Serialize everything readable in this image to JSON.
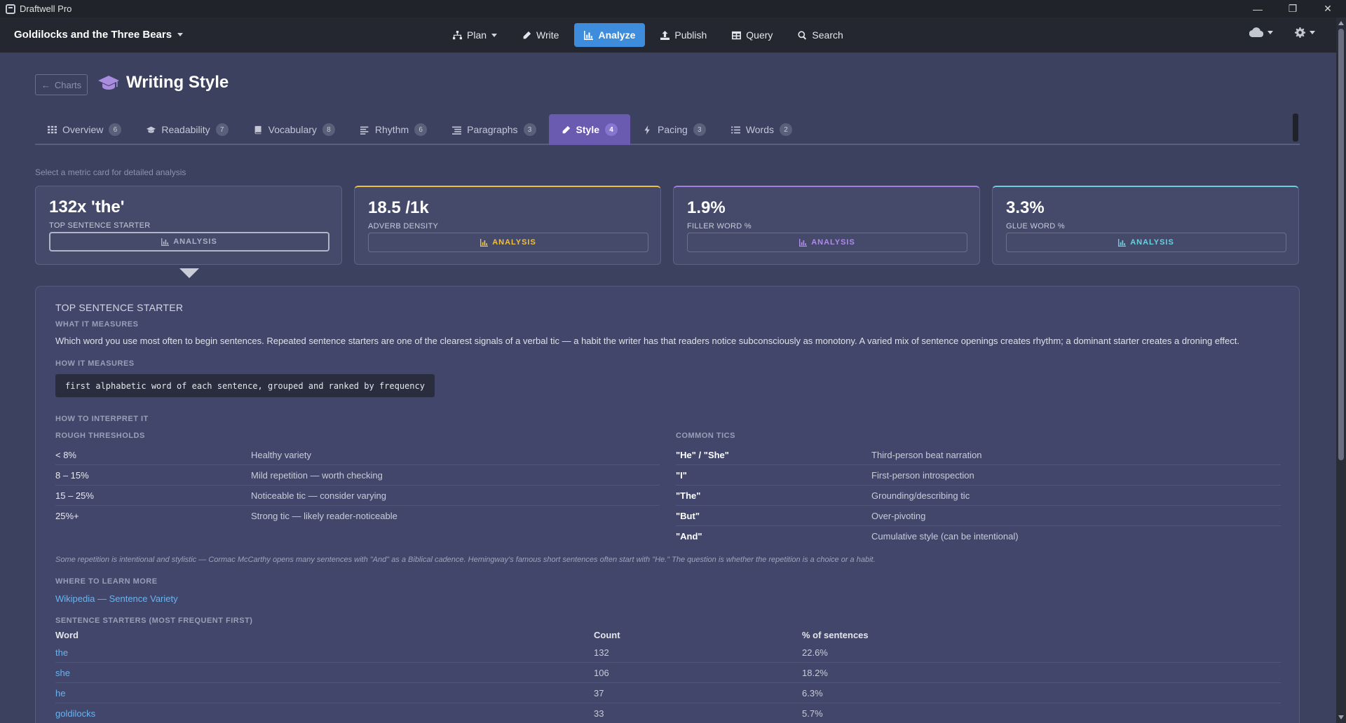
{
  "window": {
    "app_title": "Draftwell Pro"
  },
  "topnav": {
    "doc_title": "Goldilocks and the Three Bears",
    "buttons": [
      {
        "label": "Plan",
        "icon": "sitemap-icon"
      },
      {
        "label": "Write",
        "icon": "pencil-icon"
      },
      {
        "label": "Analyze",
        "icon": "bar-chart-icon",
        "active": true
      },
      {
        "label": "Publish",
        "icon": "upload-icon"
      },
      {
        "label": "Query",
        "icon": "table-icon"
      },
      {
        "label": "Search",
        "icon": "search-icon"
      }
    ]
  },
  "header": {
    "back_label": "Charts",
    "title": "Writing Style",
    "title_icon": "graduation-cap-icon"
  },
  "tabs": [
    {
      "label": "Overview",
      "count": "6",
      "icon": "grid-icon"
    },
    {
      "label": "Readability",
      "count": "7",
      "icon": "graduation-cap-icon"
    },
    {
      "label": "Vocabulary",
      "count": "8",
      "icon": "book-icon"
    },
    {
      "label": "Rhythm",
      "count": "6",
      "icon": "align-icon"
    },
    {
      "label": "Paragraphs",
      "count": "3",
      "icon": "paragraph-icon"
    },
    {
      "label": "Style",
      "count": "4",
      "icon": "pencil-icon",
      "active": true
    },
    {
      "label": "Pacing",
      "count": "3",
      "icon": "bolt-icon"
    },
    {
      "label": "Words",
      "count": "2",
      "icon": "list-icon"
    }
  ],
  "hint": "Select a metric card for detailed analysis",
  "cards": [
    {
      "value": "132x 'the'",
      "label": "TOP SENTENCE STARTER",
      "button": "ANALYSIS",
      "accent": "#b0b5c8"
    },
    {
      "value": "18.5 /1k",
      "label": "ADVERB DENSITY",
      "button": "ANALYSIS",
      "accent": "#f0c040"
    },
    {
      "value": "1.9%",
      "label": "FILLER WORD %",
      "button": "ANALYSIS",
      "accent": "#a67de0"
    },
    {
      "value": "3.3%",
      "label": "GLUE WORD %",
      "button": "ANALYSIS",
      "accent": "#6ad0e0"
    }
  ],
  "detail": {
    "title": "TOP SENTENCE STARTER",
    "what_label": "WHAT IT MEASURES",
    "what_text": "Which word you use most often to begin sentences. Repeated sentence starters are one of the clearest signals of a verbal tic — a habit the writer has that readers notice subconsciously as monotony. A varied mix of sentence openings creates rhythm; a dominant starter creates a droning effect.",
    "how_label": "HOW IT MEASURES",
    "how_code": "first alphabetic word of each sentence, grouped and ranked by frequency",
    "interpret_label": "HOW TO INTERPRET IT",
    "thresholds_label": "ROUGH THRESHOLDS",
    "thresholds": [
      {
        "range": "< 8%",
        "meaning": "Healthy variety"
      },
      {
        "range": "8 – 15%",
        "meaning": "Mild repetition — worth checking"
      },
      {
        "range": "15 – 25%",
        "meaning": "Noticeable tic — consider varying"
      },
      {
        "range": "25%+",
        "meaning": "Strong tic — likely reader-noticeable"
      }
    ],
    "tics_label": "COMMON TICS",
    "tics": [
      {
        "word": "\"He\" / \"She\"",
        "meaning": "Third-person beat narration"
      },
      {
        "word": "\"I\"",
        "meaning": "First-person introspection"
      },
      {
        "word": "\"The\"",
        "meaning": "Grounding/describing tic"
      },
      {
        "word": "\"But\"",
        "meaning": "Over-pivoting"
      },
      {
        "word": "\"And\"",
        "meaning": "Cumulative style (can be intentional)"
      }
    ],
    "note": "Some repetition is intentional and stylistic — Cormac McCarthy opens many sentences with \"And\" as a Biblical cadence. Hemingway's famous short sentences often start with \"He.\" The question is whether the repetition is a choice or a habit.",
    "learn_label": "WHERE TO LEARN MORE",
    "learn_link": "Wikipedia — Sentence Variety",
    "starters_label": "SENTENCE STARTERS (MOST FREQUENT FIRST)",
    "starters_headers": {
      "word": "Word",
      "count": "Count",
      "pct": "% of sentences"
    },
    "starters": [
      {
        "word": "the",
        "count": "132",
        "pct": "22.6%"
      },
      {
        "word": "she",
        "count": "106",
        "pct": "18.2%"
      },
      {
        "word": "he",
        "count": "37",
        "pct": "6.3%"
      },
      {
        "word": "goldilocks",
        "count": "33",
        "pct": "5.7%"
      }
    ]
  },
  "colors": {
    "accent_blue": "#3d8ddc",
    "active_tab": "#6a5ab0",
    "link": "#6ab4f0"
  }
}
